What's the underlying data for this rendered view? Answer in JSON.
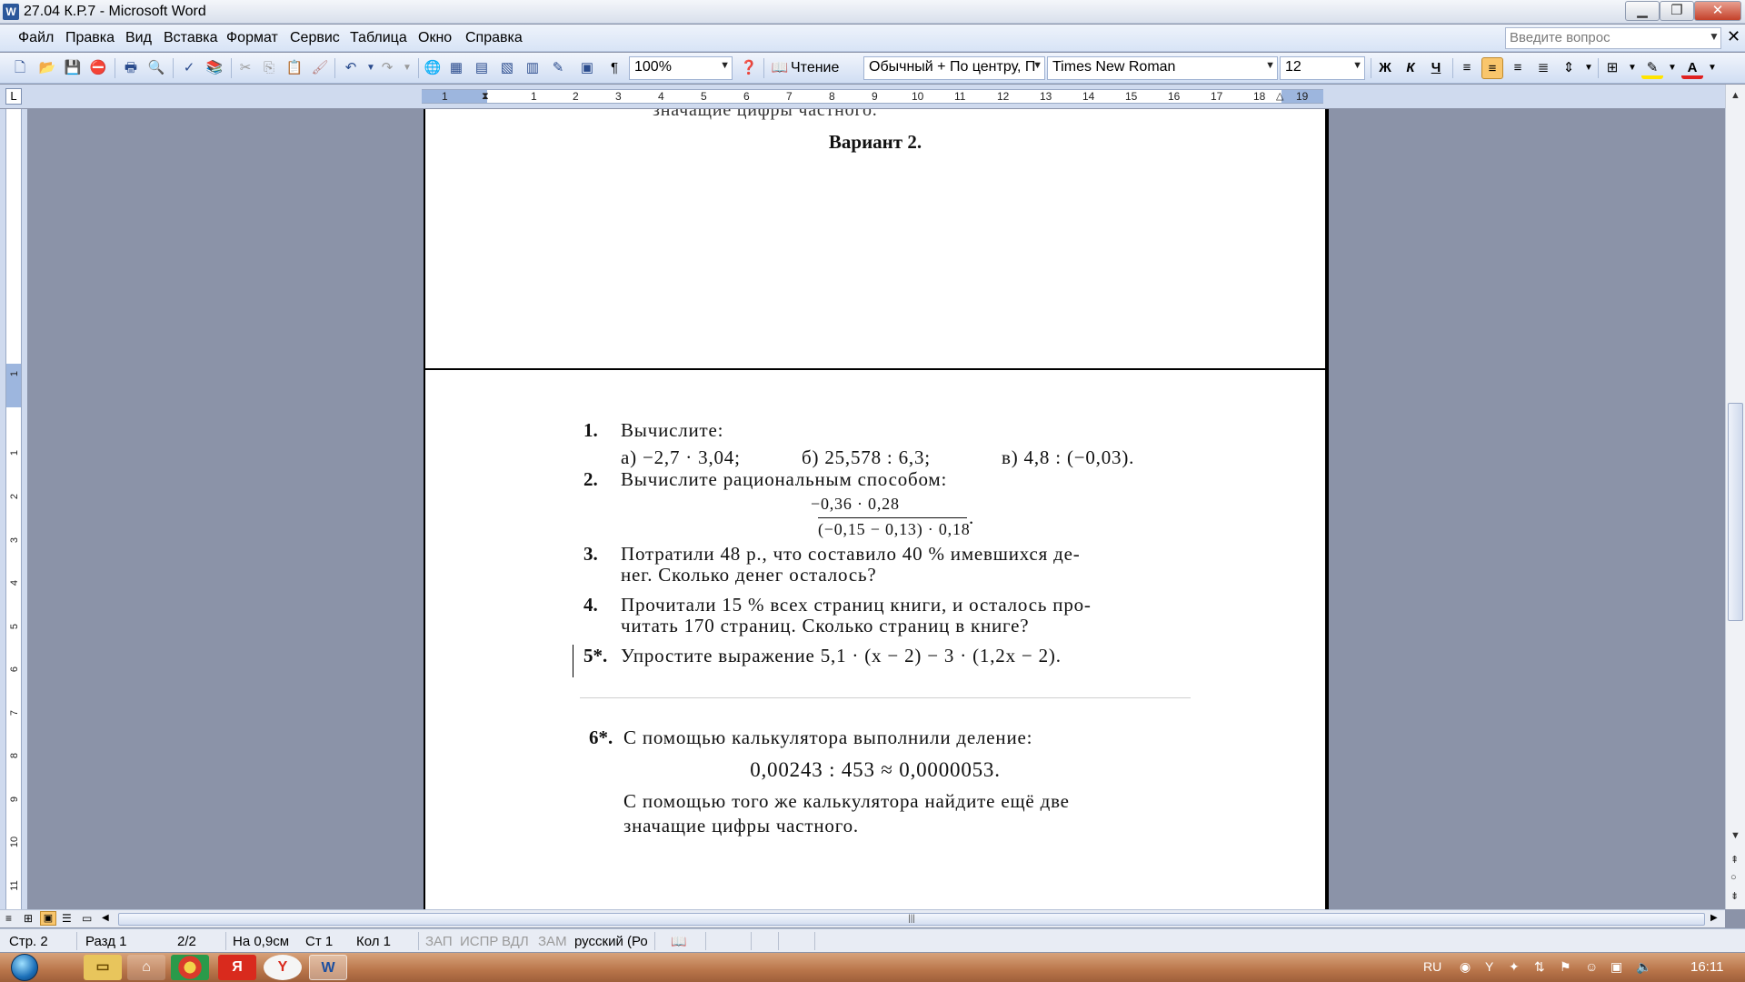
{
  "window": {
    "title": "27.04 К.Р.7 - Microsoft Word",
    "minimize": "▁",
    "restore": "❐",
    "close": "✕"
  },
  "menu": {
    "items": [
      "Файл",
      "Правка",
      "Вид",
      "Вставка",
      "Формат",
      "Сервис",
      "Таблица",
      "Окно",
      "Справка"
    ],
    "ask_placeholder": "Введите вопрос",
    "doc_close": "✕"
  },
  "toolbar": {
    "zoom": "100%",
    "reading": "Чтение",
    "style": "Обычный + По центру, П",
    "font": "Times New Roman",
    "size": "12",
    "bold": "Ж",
    "italic": "К",
    "underline": "Ч",
    "pilcrow": "¶"
  },
  "ruler": {
    "corner": "L",
    "ticks": [
      "1",
      "1",
      "2",
      "3",
      "4",
      "5",
      "6",
      "7",
      "8",
      "9",
      "10",
      "11",
      "12",
      "13",
      "14",
      "15",
      "16",
      "17",
      "18",
      "19"
    ],
    "vticks": [
      "1",
      "1",
      "2",
      "3",
      "4",
      "5",
      "6",
      "7",
      "8",
      "9",
      "10",
      "11"
    ]
  },
  "page1": {
    "cut_text": "значащие цифры частного.",
    "variant": "Вариант 2."
  },
  "page2": {
    "q1_num": "1.",
    "q1_text": "Вычислите:",
    "q1_a": "а) −2,7 · 3,04;",
    "q1_b": "б) 25,578 : 6,3;",
    "q1_c": "в) 4,8 : (−0,03).",
    "q2_num": "2.",
    "q2_text": "Вычислите рациональным способом:",
    "q2_numer": "−0,36 · 0,28",
    "q2_denom": "(−0,15 − 0,13) · 0,18",
    "q2_dot": ".",
    "q3_num": "3.",
    "q3_l1": "Потратили 48 р., что составило 40 % имевшихся де-",
    "q3_l2": "нег. Сколько денег осталось?",
    "q4_num": "4.",
    "q4_l1": "Прочитали 15 % всех страниц книги, и осталось про-",
    "q4_l2": "читать 170 страниц. Сколько страниц в книге?",
    "q5_num": "5*.",
    "q5_text": "Упростите выражение 5,1 · (x − 2) − 3 · (1,2x − 2).",
    "q6_num": "6*.",
    "q6_l1": "С помощью калькулятора выполнили деление:",
    "q6_eq": "0,00243 : 453 ≈ 0,0000053.",
    "q6_l2": "С помощью того же калькулятора найдите ещё две",
    "q6_l3": "значащие цифры частного."
  },
  "status": {
    "page": "Стр. 2",
    "section": "Разд 1",
    "pages": "2/2",
    "at": "На 0,9см",
    "line": "Ст 1",
    "col": "Кол 1",
    "rec": "ЗАП",
    "trk": "ИСПР",
    "ext": "ВДЛ",
    "ovr": "ЗАМ",
    "lang": "русский (Ро"
  },
  "taskbar": {
    "lang": "RU",
    "time": "16:11",
    "yandex": "Я",
    "yabrowser": "Y",
    "word": "W"
  }
}
